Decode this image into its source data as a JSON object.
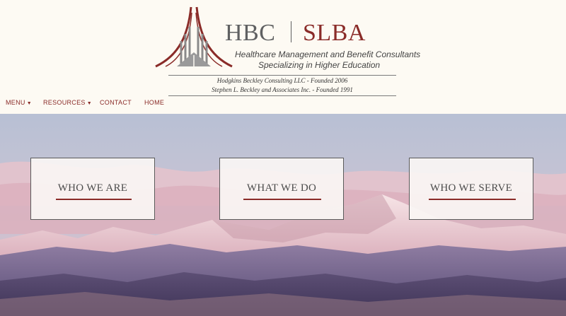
{
  "logo": {
    "hbc": "HBC",
    "slba": "SLBA",
    "tagline_line1": "Healthcare Management and Benefit Consultants",
    "tagline_line2": "Specializing in Higher Education",
    "founded_line1": "Hodgkins Beckley Consulting LLC - Founded 2006",
    "founded_line2": "Stephen L. Beckley and Associates Inc. - Founded 1991"
  },
  "nav": {
    "menu": "MENU",
    "resources": "RESOURCES",
    "contact": "CONTACT",
    "home": "HOME"
  },
  "cards": {
    "who_we_are": "WHO WE ARE",
    "what_we_do": "WHAT WE DO",
    "who_we_serve": "WHO WE SERVE"
  },
  "icons": {
    "logo_mark": "bridge-logo-icon",
    "menu_caret": "caret-down-icon",
    "resources_caret": "caret-down-icon"
  },
  "colors": {
    "brand_red": "#8a2b28",
    "brand_gray": "#5f6061",
    "header_bg": "#fdfaf3"
  }
}
